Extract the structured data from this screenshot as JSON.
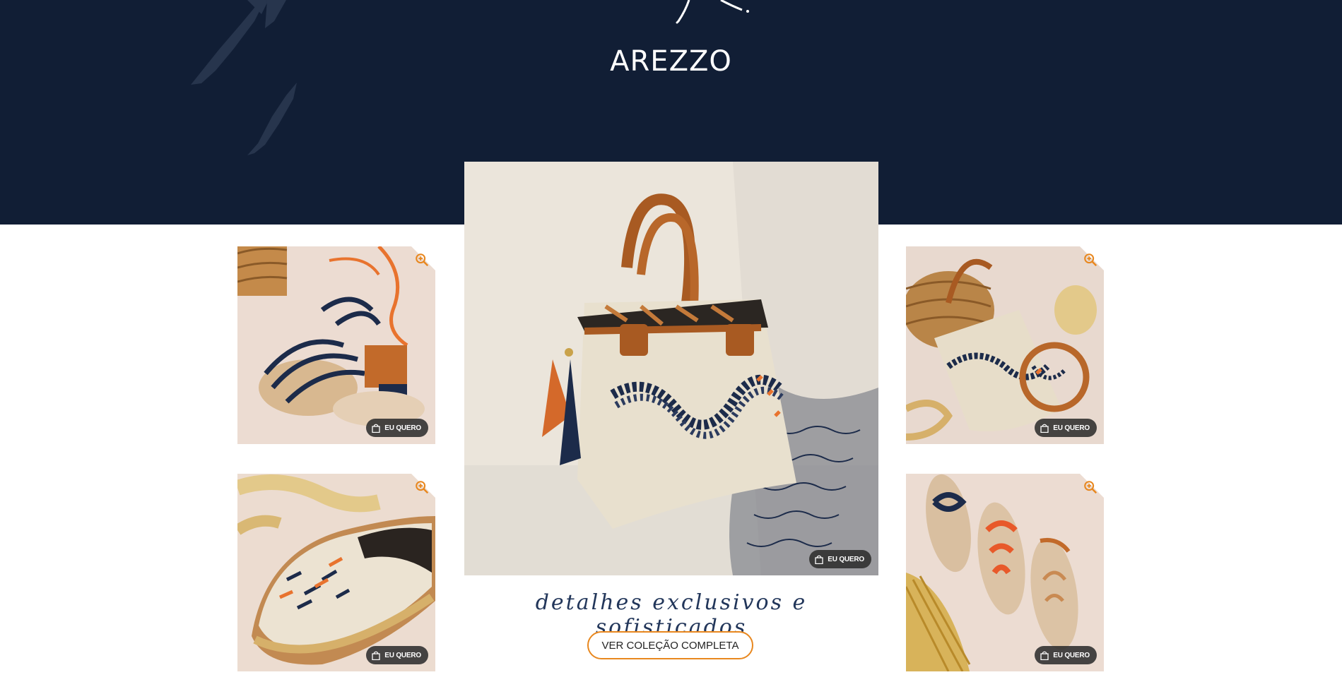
{
  "hero": {
    "brand": "AREZZO",
    "background": "#111e35"
  },
  "products": {
    "buy_label": "EU QUERO",
    "zoom_icon": "zoom-in-icon",
    "buy_icon": "shopping-bag-icon",
    "items": [
      {
        "description": "navy rope strappy block-heel sandal"
      },
      {
        "description": "canvas espadrille with embroidered fish"
      },
      {
        "description": "embroidered canvas handbag with tassels"
      },
      {
        "description": "canvas bucket bag and round crossbody"
      },
      {
        "description": "flat sandals with orange and navy knots"
      }
    ]
  },
  "tagline": "detalhes exclusivos e sofisticados",
  "cta_label": "VER COLEÇÃO COMPLETA",
  "colors": {
    "accent": "#e8871e",
    "navy": "#22365a"
  }
}
